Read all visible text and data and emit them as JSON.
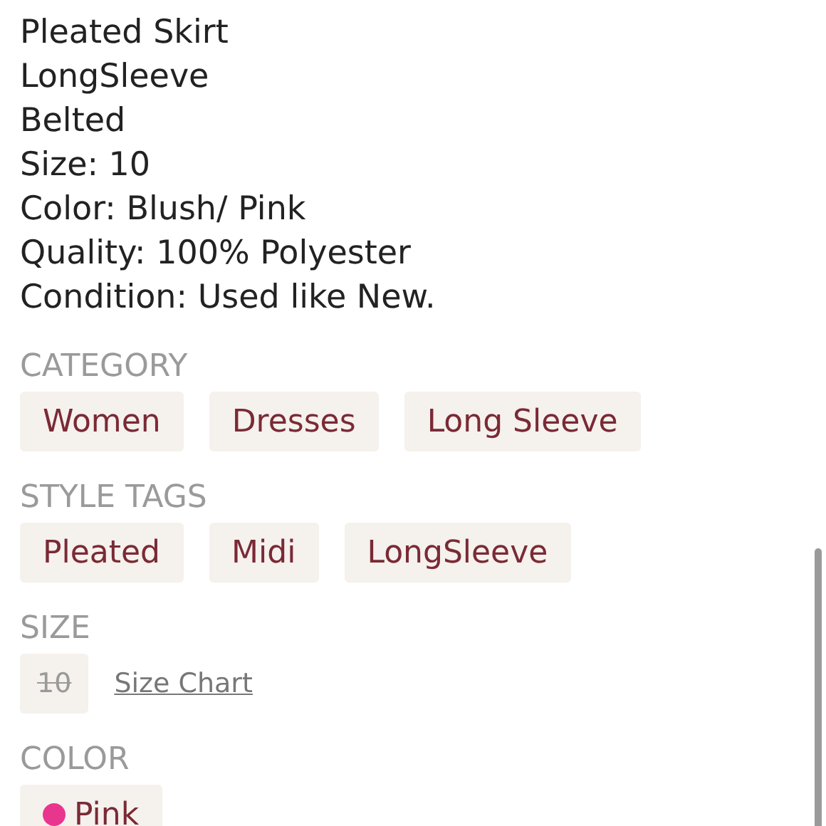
{
  "description": [
    "Pleated Skirt",
    "LongSleeve",
    "Belted",
    "Size: 10",
    "Color: Blush/ Pink",
    "Quality: 100% Polyester",
    "Condition: Used like New."
  ],
  "category": {
    "heading": "CATEGORY",
    "chips": [
      "Women",
      "Dresses",
      "Long Sleeve"
    ]
  },
  "style_tags": {
    "heading": "STYLE TAGS",
    "chips": [
      "Pleated",
      "Midi",
      "LongSleeve"
    ]
  },
  "size": {
    "heading": "SIZE",
    "options": [
      {
        "label": "10",
        "unavailable": true
      }
    ],
    "link": "Size Chart"
  },
  "color": {
    "heading": "COLOR",
    "options": [
      {
        "label": "Pink",
        "color": "#e8368f"
      }
    ]
  }
}
